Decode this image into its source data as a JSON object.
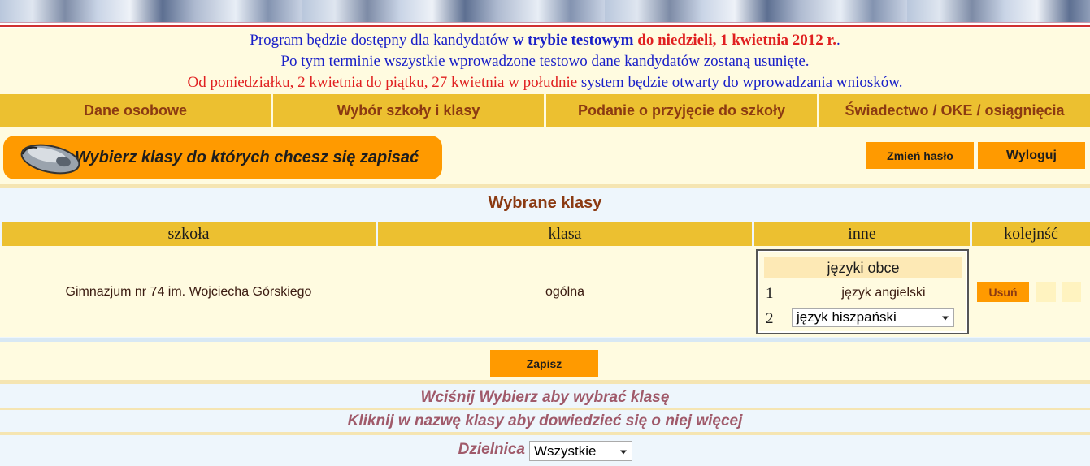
{
  "notice": {
    "line1_a": "Program będzie dostępny dla kandydatów ",
    "line1_b": "w trybie testowym",
    "line1_c": " do niedzieli, 1 kwietnia 2012 r.",
    "line1_d": ".",
    "line2": "Po tym terminie wszystkie wprowadzone testowo dane kandydatów zostaną usunięte.",
    "line3_a": "Od poniedziałku, 2 kwietnia do piątku, 27 kwietnia w południe",
    "line3_b": " system będzie otwarty do wprowadzania wniosków."
  },
  "nav": {
    "items": [
      "Dane osobowe",
      "Wybór szkoły i klasy",
      "Podanie o przyjęcie do szkoły",
      "Świadectwo / OKE / osiągnięcia"
    ]
  },
  "hint": "Wybierz klasy do których chcesz się zapisać",
  "account": {
    "change_password": "Zmień hasło",
    "logout": "Wyloguj"
  },
  "selected": {
    "title": "Wybrane klasy",
    "headers": [
      "szkoła",
      "klasa",
      "inne",
      "kolejnść"
    ],
    "row": {
      "school": "Gimnazjum nr 74 im. Wojciecha Górskiego",
      "class": "ogólna",
      "languages": {
        "title": "języki obce",
        "num1": "1",
        "lang1": "język angielski",
        "num2": "2",
        "lang2": "język hiszpański"
      },
      "remove": "Usuń"
    },
    "save": "Zapisz"
  },
  "footer": {
    "line1": "Wciśnij Wybierz aby wybrać klasę",
    "line2": "Kliknij w nazwę klasy aby dowiedzieć się o niej więcej",
    "district_label": "Dzielnica",
    "district_value": "Wszystkie"
  },
  "colors": {
    "nav_bg": "#ecc030",
    "nav_text": "#8b3a12",
    "button_bg": "#ff9a00",
    "notice_blue": "#1a20c8",
    "notice_red": "#e02020"
  }
}
